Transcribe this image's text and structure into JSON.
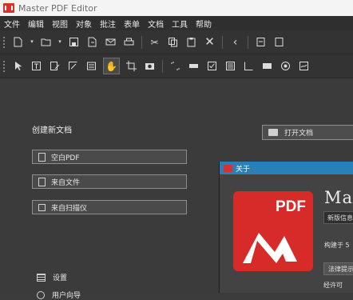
{
  "window": {
    "title": "Master PDF Editor"
  },
  "menu": [
    "文件",
    "编辑",
    "视图",
    "对象",
    "批注",
    "表单",
    "文档",
    "工具",
    "帮助"
  ],
  "toolbar_main": [
    "new-doc-icon",
    "open-icon",
    "save-icon",
    "save-as-icon",
    "email-icon",
    "print-icon",
    "cut-icon",
    "copy-icon",
    "paste-icon",
    "delete-icon",
    "back-icon",
    "page-icon"
  ],
  "toolbar_tools": [
    "select-cursor-icon",
    "text-icon",
    "edit-text-icon",
    "edit-object-icon",
    "form-icon",
    "hand-icon",
    "crop-icon",
    "image-icon",
    "link-icon",
    "textfield-icon",
    "checkbox-icon",
    "radio-icon",
    "listbox-icon",
    "button-icon",
    "radio-circle-icon",
    "signature-icon"
  ],
  "start": {
    "create_title": "创建新文档",
    "blank_pdf": "空白PDF",
    "from_file": "来自文件",
    "from_scanner": "来自扫描仪",
    "open_doc": "打开文档",
    "settings": "设置",
    "help": "用户向导"
  },
  "about": {
    "title": "关于",
    "logo_text": "PDF",
    "app_name": "Mast",
    "info_tab": "新版信息",
    "built": "构建于 5",
    "legal_tab": "法律提示",
    "text": "经许可"
  },
  "colors": {
    "accent_blue": "#2980b9",
    "brand_red": "#d62b29"
  }
}
